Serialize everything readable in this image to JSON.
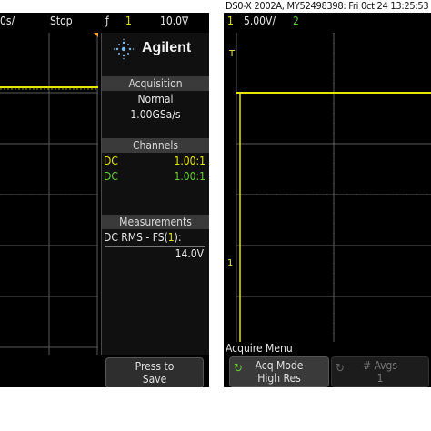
{
  "caption": "DS0-X 2002A, MY52498398: Fri 0ct 24 13:25:53 2",
  "left": {
    "top_bar": {
      "scale": "0s/",
      "run_state": "Stop",
      "trigger_icon": "trigger-edge-icon",
      "trigger_channel": "1",
      "trigger_level": "10.0∇"
    },
    "brand": {
      "logo_icon": "agilent-spark-icon",
      "name": "Agilent"
    },
    "acquisition": {
      "header": "Acquisition",
      "mode": "Normal",
      "rate": "1.00GSa/s"
    },
    "channels": {
      "header": "Channels",
      "rows": [
        {
          "coupling": "DC",
          "probe": "1.00:1",
          "color": "#e6e600"
        },
        {
          "coupling": "DC",
          "probe": "1.00:1",
          "color": "#66cc33"
        }
      ]
    },
    "measurements": {
      "header": "Measurements",
      "label_prefix": "DC RMS - FS(",
      "label_channel": "1",
      "label_suffix": "):",
      "value": "14.0V"
    },
    "softkey": {
      "line1": "Press to",
      "line2": "Save"
    }
  },
  "right": {
    "top_bar": {
      "channel": "1",
      "scale": "5.00V/",
      "channel2": "2"
    },
    "markers": {
      "trigger_marker": "T",
      "ground_marker": "1"
    },
    "menu_label": "Acquire Menu",
    "softkeys": [
      {
        "icon": "rotate-knob-icon",
        "line1": "Acq Mode",
        "line2": "High Res",
        "enabled": true
      },
      {
        "icon": "rotate-knob-icon",
        "line1": "# Avgs",
        "line2": "1",
        "enabled": false
      }
    ]
  },
  "colors": {
    "ch1": "#e6e600",
    "ch2": "#66cc33",
    "grid": "#5a5a5a",
    "trigger_marker": "#f0a030"
  }
}
